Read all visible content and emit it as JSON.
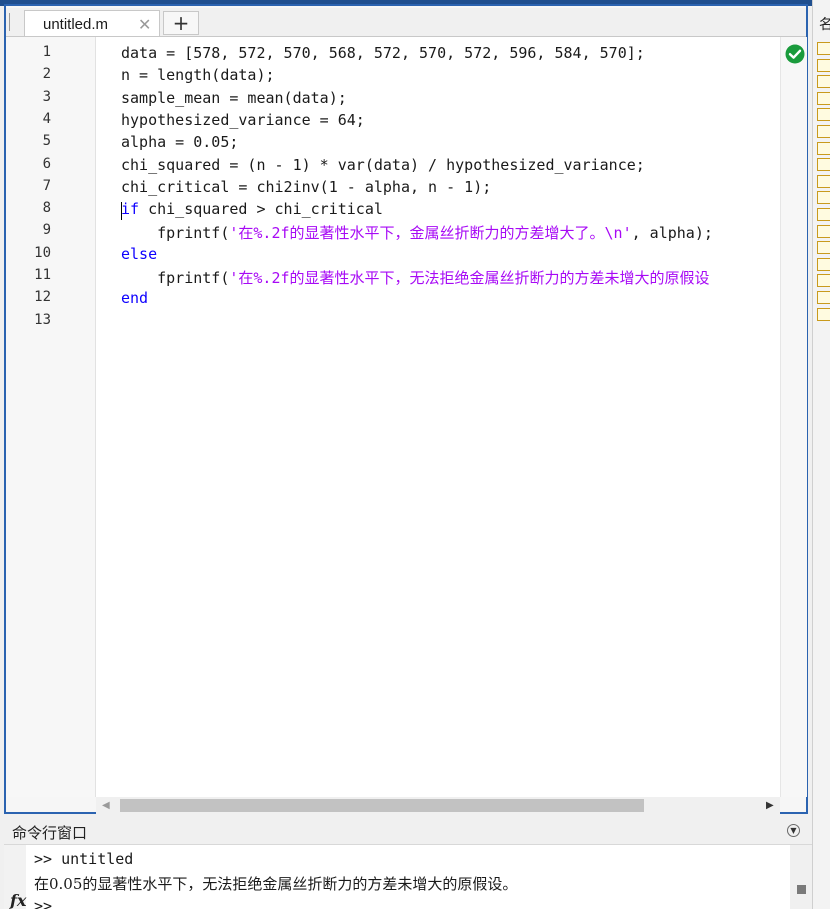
{
  "editor": {
    "tab_label": "untitled.m",
    "tab_close": "✕",
    "tab_add": "+",
    "line_numbers": [
      "1",
      "2",
      "3",
      "4",
      "5",
      "6",
      "7",
      "8",
      "9",
      "10",
      "11",
      "12",
      "13"
    ],
    "lines": [
      {
        "parts": [
          {
            "t": "data = [578, 572, 570, 568, 572, 570, 572, 596, 584, 570];",
            "c": ""
          }
        ]
      },
      {
        "parts": [
          {
            "t": "n = length(data);",
            "c": ""
          }
        ]
      },
      {
        "parts": [
          {
            "t": "sample_mean = mean(data);",
            "c": ""
          }
        ]
      },
      {
        "parts": [
          {
            "t": "hypothesized_variance = 64;",
            "c": ""
          }
        ]
      },
      {
        "parts": [
          {
            "t": "alpha = 0.05;",
            "c": ""
          }
        ]
      },
      {
        "parts": [
          {
            "t": "chi_squared = (n - 1) * var(data) / hypothesized_variance;",
            "c": ""
          }
        ]
      },
      {
        "parts": [
          {
            "t": "chi_critical = chi2inv(1 - alpha, n - 1);",
            "c": ""
          }
        ]
      },
      {
        "parts": [
          {
            "t": "if",
            "c": "kw"
          },
          {
            "t": " chi_squared > chi_critical",
            "c": ""
          }
        ]
      },
      {
        "parts": [
          {
            "t": "    fprintf(",
            "c": ""
          },
          {
            "t": "'在%.2f的显著性水平下，金属丝折断力的方差增大了。\\n'",
            "c": "str"
          },
          {
            "t": ", alpha);",
            "c": ""
          }
        ]
      },
      {
        "parts": [
          {
            "t": "else",
            "c": "kw"
          }
        ]
      },
      {
        "parts": [
          {
            "t": "    fprintf(",
            "c": ""
          },
          {
            "t": "'在%.2f的显著性水平下，无法拒绝金属丝折断力的方差未增大的原假设",
            "c": "str"
          }
        ]
      },
      {
        "parts": [
          {
            "t": "end",
            "c": "kw"
          }
        ]
      },
      {
        "parts": []
      }
    ],
    "status_icon": "check-circle-icon",
    "cursor_line": 8
  },
  "side_panel": {
    "title": "名"
  },
  "command_window": {
    "title": "命令行窗口",
    "collapse_icon": "chevron-down-icon",
    "lines": [
      ">> untitled",
      "在0.05的显著性水平下，无法拒绝金属丝折断力的方差未增大的原假设。"
    ],
    "prompt": ">>",
    "fx_label": "fx"
  },
  "colors": {
    "keyword": "#0e00ff",
    "string": "#a709f5",
    "frame_border": "#2b63b0",
    "ok_green": "#1a9b3c"
  }
}
